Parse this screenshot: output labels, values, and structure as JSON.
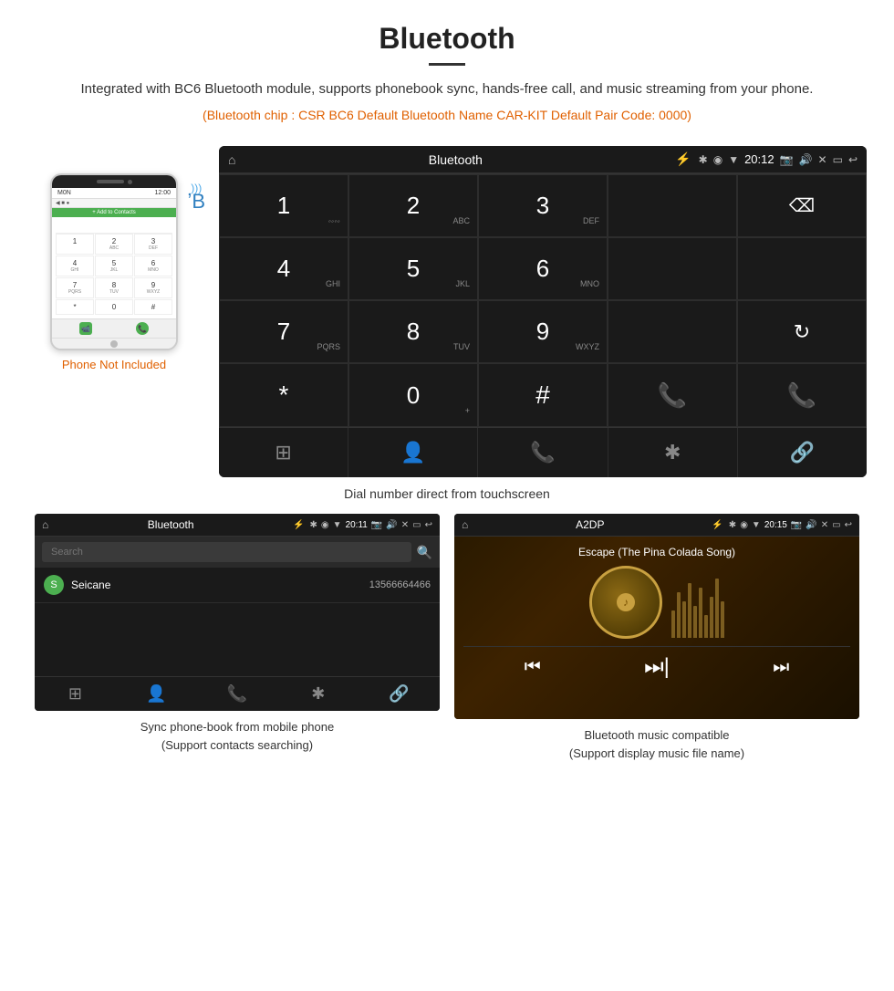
{
  "page": {
    "title": "Bluetooth",
    "divider": true,
    "description": "Integrated with BC6 Bluetooth module, supports phonebook sync, hands-free call, and music streaming from your phone.",
    "specs": "(Bluetooth chip : CSR BC6    Default Bluetooth Name CAR-KIT    Default Pair Code: 0000)",
    "phone_not_included": "Phone Not Included"
  },
  "car_screen": {
    "status_bar": {
      "home_icon": "⌂",
      "title": "Bluetooth",
      "usb_icon": "⚡",
      "bt_icon": "✱",
      "location_icon": "◉",
      "signal_icon": "▼",
      "time": "20:12",
      "camera_icon": "📷",
      "volume_icon": "🔊",
      "close_icon": "✕",
      "screen_icon": "▭",
      "back_icon": "↩"
    },
    "dialpad": {
      "keys": [
        {
          "num": "1",
          "sub": ""
        },
        {
          "num": "2",
          "sub": "ABC"
        },
        {
          "num": "3",
          "sub": "DEF"
        },
        {
          "num": "",
          "sub": ""
        },
        {
          "num": "⌫",
          "sub": ""
        },
        {
          "num": "4",
          "sub": "GHI"
        },
        {
          "num": "5",
          "sub": "JKL"
        },
        {
          "num": "6",
          "sub": "MNO"
        },
        {
          "num": "",
          "sub": ""
        },
        {
          "num": "",
          "sub": ""
        },
        {
          "num": "7",
          "sub": "PQRS"
        },
        {
          "num": "8",
          "sub": "TUV"
        },
        {
          "num": "9",
          "sub": "WXYZ"
        },
        {
          "num": "",
          "sub": ""
        },
        {
          "num": "↻",
          "sub": ""
        },
        {
          "num": "*",
          "sub": ""
        },
        {
          "num": "0",
          "sub": "+"
        },
        {
          "num": "#",
          "sub": ""
        },
        {
          "num": "📞",
          "sub": ""
        },
        {
          "num": "📞",
          "sub": "red"
        }
      ]
    },
    "bottom_nav": [
      "⊞",
      "👤",
      "📞",
      "✱",
      "🔗"
    ]
  },
  "caption_main": "Dial number direct from touchscreen",
  "phonebook_screen": {
    "status_bar": {
      "home_icon": "⌂",
      "title": "Bluetooth",
      "usb_icon": "⚡",
      "bt_icon": "✱",
      "location_icon": "◉",
      "signal_icon": "▼",
      "time": "20:11",
      "camera_icon": "📷",
      "volume_icon": "🔊",
      "close_icon": "✕",
      "screen_icon": "▭",
      "back_icon": "↩"
    },
    "search_placeholder": "Search",
    "contacts": [
      {
        "letter": "S",
        "name": "Seicane",
        "phone": "13566664466"
      }
    ],
    "bottom_nav": [
      "⊞",
      "👤",
      "📞",
      "✱",
      "🔗"
    ]
  },
  "music_screen": {
    "status_bar": {
      "home_icon": "⌂",
      "title": "A2DP",
      "usb_icon": "⚡",
      "bt_icon": "✱",
      "location_icon": "◉",
      "signal_icon": "▼",
      "time": "20:15",
      "camera_icon": "📷",
      "volume_icon": "🔊",
      "close_icon": "✕",
      "screen_icon": "▭",
      "back_icon": "↩"
    },
    "song_title": "Escape (The Pina Colada Song)",
    "music_icon": "♪",
    "controls": {
      "prev": "⏮",
      "play_pause": "⏭",
      "next": "⏭"
    }
  },
  "captions": {
    "phonebook": "Sync phone-book from mobile phone",
    "phonebook_sub": "(Support contacts searching)",
    "music": "Bluetooth music compatible",
    "music_sub": "(Support display music file name)"
  }
}
